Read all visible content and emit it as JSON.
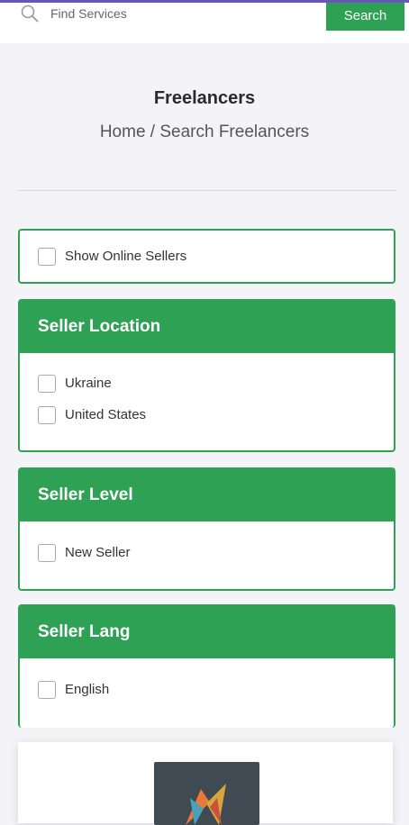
{
  "search": {
    "placeholder": "Find Services",
    "button_label": "Search"
  },
  "header": {
    "title": "Freelancers",
    "breadcrumb": "Home / Search Freelancers"
  },
  "filters": {
    "online": {
      "label": "Show Online Sellers"
    },
    "location": {
      "title": "Seller Location",
      "options": [
        "Ukraine",
        "United States"
      ]
    },
    "level": {
      "title": "Seller Level",
      "options": [
        "New Seller"
      ]
    },
    "lang": {
      "title": "Seller Lang",
      "options": [
        "English"
      ]
    }
  },
  "colors": {
    "accent": "#2ea155",
    "topline": "#6a55b8"
  }
}
